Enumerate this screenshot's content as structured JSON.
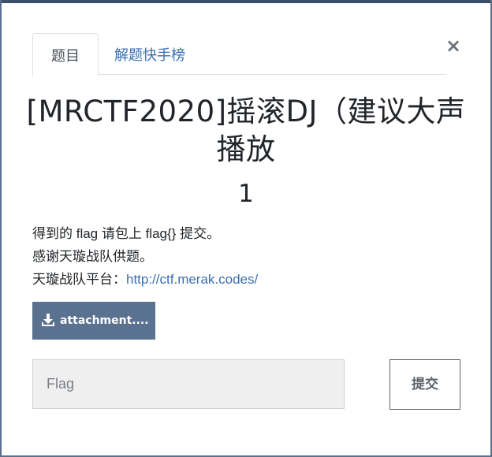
{
  "tabs": {
    "active_label": "题目",
    "solves_label": "解题快手榜"
  },
  "close": {
    "glyph": "×"
  },
  "challenge": {
    "title": "[MRCTF2020]摇滚DJ（建议大声播放",
    "points": "1",
    "description": {
      "line1": "得到的 flag 请包上 flag{} 提交。",
      "line2": "感谢天璇战队供题。",
      "line3_prefix": "天璇战队平台：",
      "line3_link": "http://ctf.merak.codes/"
    },
    "attachment_label": "attachment....",
    "attachment_icon": "download-icon"
  },
  "form": {
    "flag_placeholder": "Flag",
    "flag_value": "",
    "submit_label": "提交"
  },
  "colors": {
    "link": "#3a6fb0",
    "attachment_bg": "#5b7190",
    "input_bg": "#efefef"
  }
}
